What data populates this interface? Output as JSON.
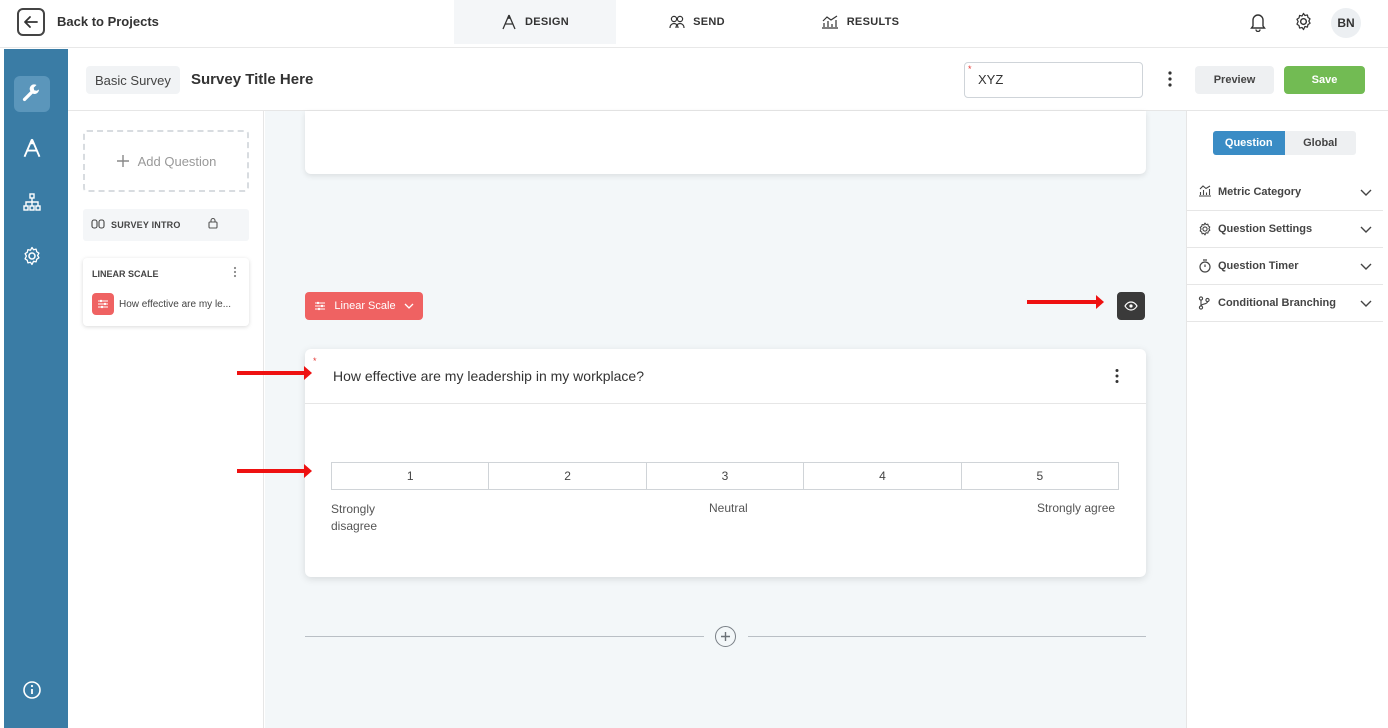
{
  "topbar": {
    "back_label": "Back to Projects",
    "nav": [
      {
        "label": "DESIGN",
        "icon": "design-icon",
        "active": true
      },
      {
        "label": "SEND",
        "icon": "users-icon",
        "active": false
      },
      {
        "label": "RESULTS",
        "icon": "results-chart-icon",
        "active": false
      }
    ],
    "avatar_initials": "BN"
  },
  "rail": {
    "items": [
      "wrench-icon",
      "design-icon",
      "hierarchy-icon",
      "gear-icon"
    ],
    "bottom": "info-icon"
  },
  "header": {
    "survey_type": "Basic Survey",
    "survey_title": "Survey Title Here",
    "required_mark": "*",
    "name_value": "XYZ",
    "preview_label": "Preview",
    "save_label": "Save"
  },
  "question_list": {
    "add_label": "Add Question",
    "intro_label": "SURVEY INTRO",
    "card": {
      "type_label": "LINEAR SCALE",
      "question_preview": "How effective are my le..."
    }
  },
  "canvas": {
    "question_type_label": "Linear Scale",
    "question": {
      "required_mark": "*",
      "text": "How effective are my leadership in my workplace?",
      "scale": [
        "1",
        "2",
        "3",
        "4",
        "5"
      ],
      "label_left": "Strongly disagree",
      "label_mid": "Neutral",
      "label_right": "Strongly agree"
    }
  },
  "settings": {
    "tabs": [
      {
        "label": "Question",
        "active": true
      },
      {
        "label": "Global",
        "active": false
      }
    ],
    "sections": [
      {
        "label": "Metric Category",
        "icon": "metric-chart-icon"
      },
      {
        "label": "Question Settings",
        "icon": "settings-gear-icon"
      },
      {
        "label": "Question Timer",
        "icon": "timer-icon"
      },
      {
        "label": "Conditional Branching",
        "icon": "branch-icon"
      }
    ]
  },
  "colors": {
    "rail": "#3a7ca5",
    "accent_red": "#ef6262",
    "save_green": "#72bb53",
    "tab_blue": "#3a8cc5",
    "annotation_red": "#e11111"
  }
}
